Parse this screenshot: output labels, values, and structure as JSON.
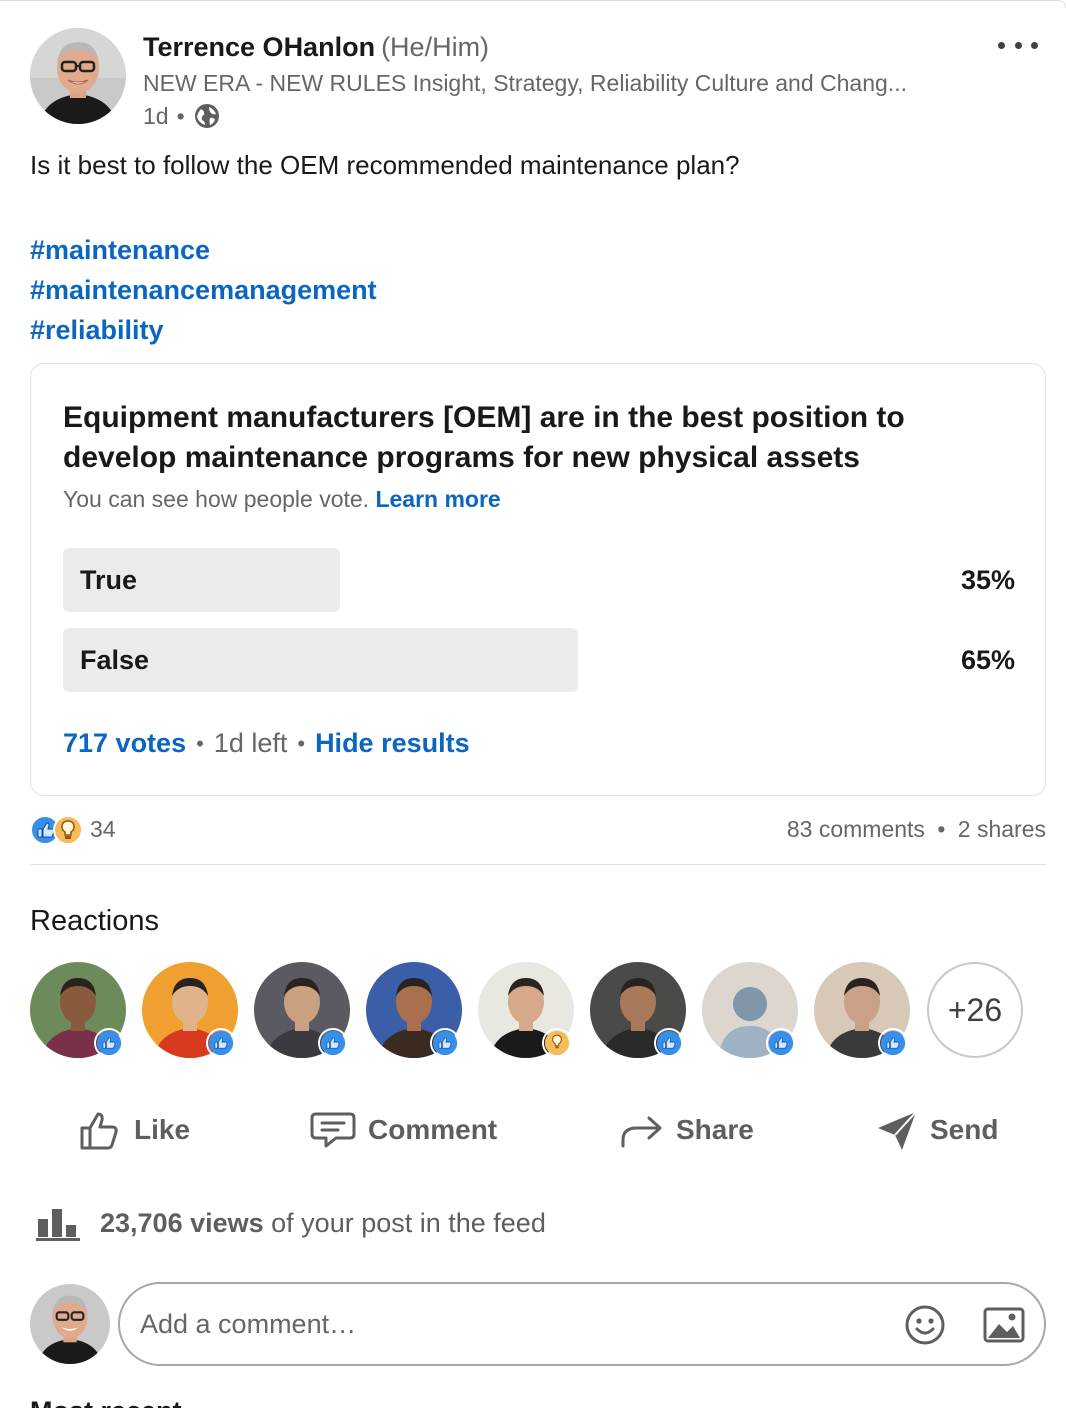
{
  "post": {
    "author_name": "Terrence OHanlon",
    "author_pronouns": "(He/Him)",
    "author_headline": "NEW ERA - NEW RULES Insight, Strategy, Reliability Culture and Chang...",
    "time_ago": "1d",
    "meta_separator": "•",
    "visibility_icon": "globe-icon",
    "more_icon": "ellipsis-icon",
    "text": "Is it best to follow the OEM recommended maintenance plan?",
    "hashtags": [
      "#maintenance",
      "#maintenancemanagement",
      "#reliability"
    ]
  },
  "poll": {
    "question": "Equipment manufacturers [OEM] are in the best position to develop maintenance programs for new physical assets",
    "subtext": "You can see how people vote.",
    "learn_more": "Learn more",
    "options": [
      {
        "label": "True",
        "percent_label": "35%",
        "fraction": 0.35
      },
      {
        "label": "False",
        "percent_label": "65%",
        "fraction": 0.65
      }
    ],
    "votes": "717 votes",
    "time_left": "1d left",
    "hide_results": "Hide results",
    "separator": "•"
  },
  "social": {
    "reaction_icons": [
      "like-icon",
      "insightful-icon"
    ],
    "reaction_count": "34",
    "comments": "83 comments",
    "shares": "2 shares",
    "separator": "•"
  },
  "reactions": {
    "title": "Reactions",
    "reactors": [
      {
        "badge": "like",
        "skin": "#8a5a3c",
        "bg": "#6d8a5a",
        "shirt": "#7a2f4a"
      },
      {
        "badge": "like",
        "skin": "#e0b38a",
        "bg": "#f0a030",
        "shirt": "#d83a20"
      },
      {
        "badge": "like",
        "skin": "#c9a080",
        "bg": "#5a5a62",
        "shirt": "#3a3a40"
      },
      {
        "badge": "like",
        "skin": "#a8704f",
        "bg": "#3a5fa8",
        "shirt": "#3a2a20"
      },
      {
        "badge": "insightful",
        "skin": "#d6a98a",
        "bg": "#e8e8e0",
        "shirt": "#1a1a1a"
      },
      {
        "badge": "like",
        "skin": "#a87a5a",
        "bg": "#4a4a48",
        "shirt": "#2a2a2a"
      },
      {
        "badge": "like",
        "skin": "#7f96ab",
        "bg": "#dcd6cf",
        "shirt": "#9fb2c4"
      },
      {
        "badge": "like",
        "skin": "#caa088",
        "bg": "#d8c8b8",
        "shirt": "#3a3a3a"
      }
    ],
    "more": "+26"
  },
  "actions": {
    "like": "Like",
    "comment": "Comment",
    "share": "Share",
    "send": "Send"
  },
  "views": {
    "icon": "bar-chart-icon",
    "count": "23,706 views",
    "suffix": "of your post in the feed"
  },
  "comment_box": {
    "placeholder": "Add a comment…",
    "emoji_icon": "emoji-icon",
    "image_icon": "image-icon"
  },
  "colors": {
    "link": "#0a66c2",
    "like_badge": "#378fe9",
    "insightful_badge": "#f5bb5c",
    "poll_fill": "#ebebeb"
  },
  "cutoff_text": "Most recent"
}
